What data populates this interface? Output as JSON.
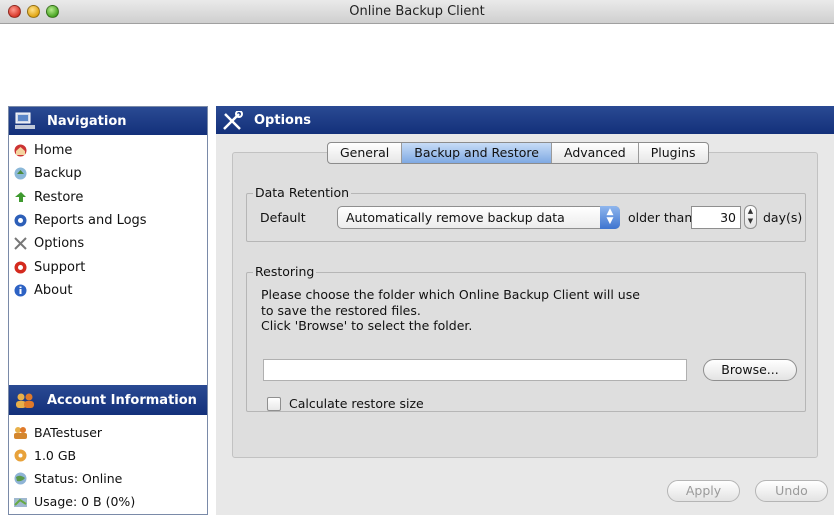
{
  "window": {
    "title": "Online Backup Client"
  },
  "navigation": {
    "header": "Navigation",
    "items": [
      {
        "label": "Home",
        "icon": "home-icon"
      },
      {
        "label": "Backup",
        "icon": "backup-icon"
      },
      {
        "label": "Restore",
        "icon": "restore-icon"
      },
      {
        "label": "Reports and Logs",
        "icon": "reports-icon"
      },
      {
        "label": "Options",
        "icon": "options-icon"
      },
      {
        "label": "Support",
        "icon": "support-icon"
      },
      {
        "label": "About",
        "icon": "about-icon"
      }
    ]
  },
  "account": {
    "header": "Account Information",
    "user": "BATestuser",
    "quota": "1.0 GB",
    "status": "Status: Online",
    "usage": "Usage: 0 B (0%)"
  },
  "options": {
    "header": "Options",
    "tabs": [
      {
        "label": "General",
        "active": false
      },
      {
        "label": "Backup and Restore",
        "active": true
      },
      {
        "label": "Advanced",
        "active": false
      },
      {
        "label": "Plugins",
        "active": false
      }
    ],
    "retention": {
      "group_label": "Data Retention",
      "default_label": "Default",
      "select_value": "Automatically remove backup data",
      "older_than_label": "older than",
      "days_value": "30",
      "days_unit": "day(s)"
    },
    "restoring": {
      "group_label": "Restoring",
      "line1": "Please choose the folder which Online Backup Client will use",
      "line2": "to save the restored files.",
      "line3": "Click 'Browse' to select the folder.",
      "folder_value": "",
      "browse_label": "Browse...",
      "checkbox_label": "Calculate restore size"
    },
    "apply_label": "Apply",
    "undo_label": "Undo"
  },
  "colors": {
    "header_bg": "#1b3a85",
    "tab_active": "#8fb4e8"
  }
}
